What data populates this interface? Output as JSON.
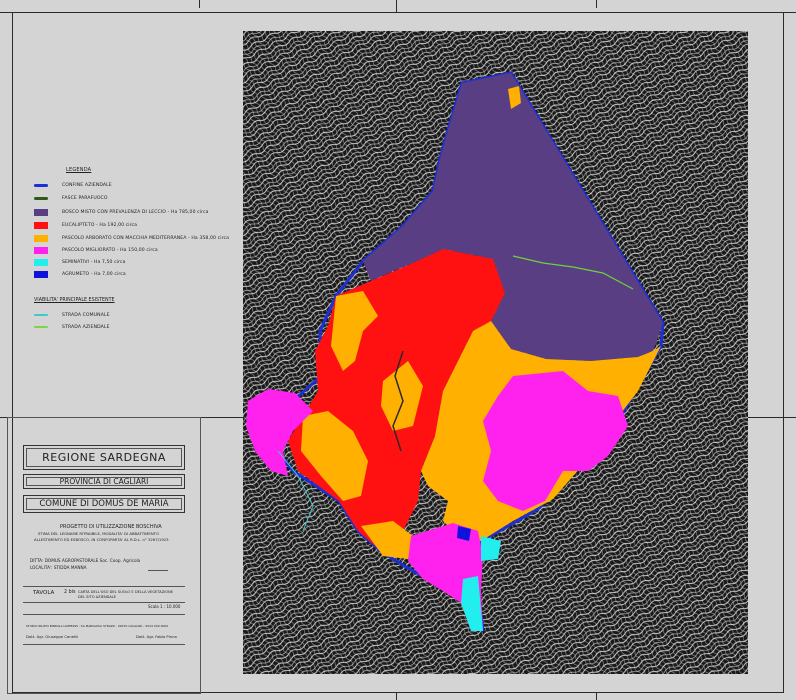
{
  "legend": {
    "title": "LEGENDA",
    "items": [
      {
        "label": "CONFINE AZIENDALE",
        "color": "#1c2fd6",
        "kind": "line"
      },
      {
        "label": "FASCE PARAFUOCO",
        "color": "#2f5a1a",
        "kind": "line"
      },
      {
        "label": "BOSCO MISTO CON PREVALENZA DI LECCIO - Ha 785,00 circa",
        "color": "#5a3e83",
        "kind": "area"
      },
      {
        "label": "EUCALIPTETO - Ha 192,00 circa",
        "color": "#ff1111",
        "kind": "area"
      },
      {
        "label": "PASCOLO ARBORATO CON MACCHIA MEDITERRANEA - Ha 358,00 circa",
        "color": "#ffb000",
        "kind": "area"
      },
      {
        "label": "PASCOLO MIGLIORATO - Ha 150,00 circa",
        "color": "#ff22ee",
        "kind": "area"
      },
      {
        "label": "SEMINATIVI - Ha 7,50 circa",
        "color": "#22eeee",
        "kind": "area"
      },
      {
        "label": "AGRUMETO - Ha 7,00 circa",
        "color": "#1111dd",
        "kind": "area"
      }
    ],
    "roads_title": "VIABILITA' PRINCIPALE ESISTENTE",
    "roads": [
      {
        "label": "STRADA COMUNALE",
        "color": "#40c8d0"
      },
      {
        "label": "STRADA AZIENDALE",
        "color": "#7fd24a"
      }
    ]
  },
  "title_block": {
    "region": "REGIONE SARDEGNA",
    "province": "PROVINCIA DI CAGLIARI",
    "comune": "COMUNE DI DOMUS DE MARIA",
    "project_title": "PROGETTO DI UTILIZZAZIONE BOSCHIVA",
    "project_line1": "STIMA DEL LEGNAME RITRAIBILE, MODALITA' DI ABBATTIMENTO",
    "project_line2": "ALLESTIMENTO ED ESBOSCO, IN CONFORMITA' AL R.D.L. n° 3267/1923",
    "ditta": "DITTA: DOMUS AGROPASTORALE Soc. Coop. Agricola",
    "localita": "LOCALITA': STIDDA MANNA",
    "tavola_label": "TAVOLA",
    "tavola_number": "2 bis",
    "tavola_desc_line1": "CARTA DELL'USO DEL SUOLO E DELLA VEGETAZIONE",
    "tavola_desc_line2": "DEL SITO AZIENDALE",
    "scale": "Scala 1 : 10.000",
    "info_line": "STUDIO RILIEVI BINDALLI AMPEZZI - SA MARIGOSA STRAZZ - 09070 CAGLIARI - 0524 000 0000",
    "author1": "Dott. Agr. Giuseppe Canetti",
    "author2": "Dott. Agr. Fabio Pinna"
  }
}
